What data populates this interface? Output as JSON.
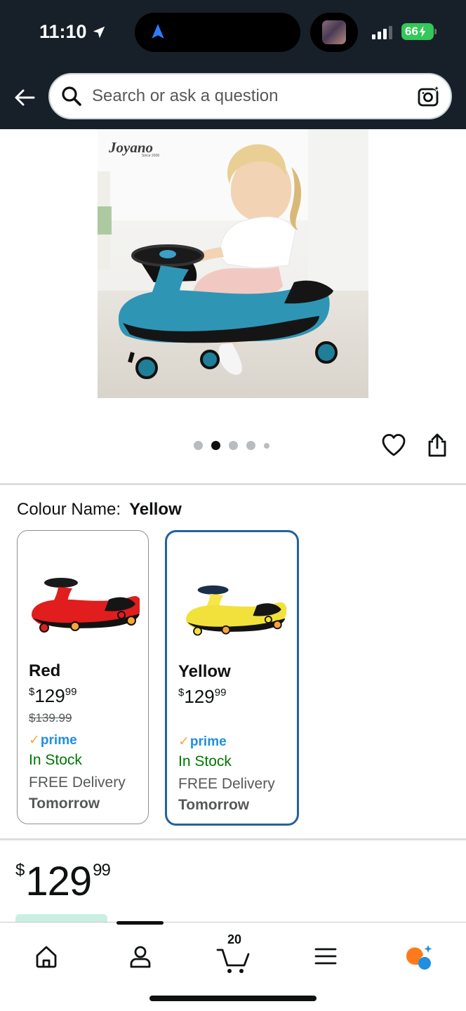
{
  "status_bar": {
    "time": "11:10",
    "battery": "66"
  },
  "header": {
    "search_placeholder": "Search or ask a question"
  },
  "product": {
    "brand": "Joyano",
    "brand_sub": "Since 2008",
    "image_count": 5,
    "active_image_index": 1
  },
  "variants": {
    "label": "Colour Name:",
    "selected_value": "Yellow",
    "cards": [
      {
        "name": "Red",
        "price_whole": "129",
        "price_cents": "99",
        "was_price": "$139.99",
        "prime": "prime",
        "stock": "In Stock",
        "delivery": "FREE Delivery",
        "day": "Tomorrow",
        "selected": false
      },
      {
        "name": "Yellow",
        "price_whole": "129",
        "price_cents": "99",
        "prime": "prime",
        "stock": "In Stock",
        "delivery": "FREE Delivery",
        "day": "Tomorrow",
        "selected": true
      }
    ]
  },
  "price": {
    "symbol": "$",
    "whole": "129",
    "cents": "99"
  },
  "tabbar": {
    "cart_count": "20"
  },
  "colors": {
    "header_bg": "#172029",
    "selected_border": "#2162a1",
    "in_stock": "#007600",
    "prime_blue": "#1f8fe0",
    "prime_check": "#f3a847",
    "ai_orange": "#ff7a1a",
    "ai_blue": "#1f8fe0"
  }
}
